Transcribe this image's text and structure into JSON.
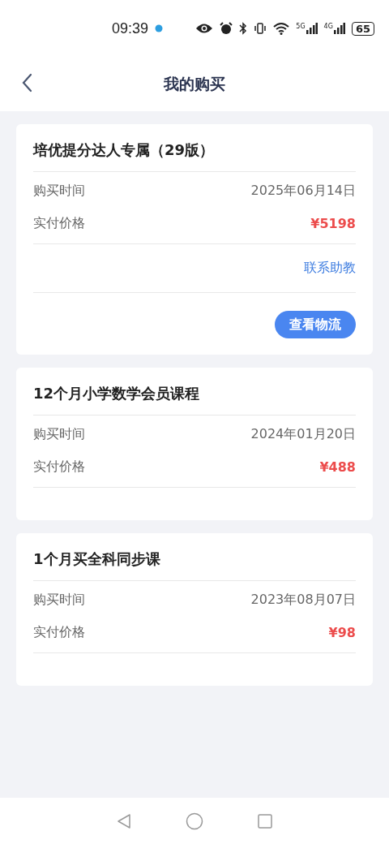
{
  "status_bar": {
    "time": "09:39",
    "network_5g": "5G",
    "network_4g": "4G",
    "battery": "65"
  },
  "header": {
    "title": "我的购买"
  },
  "orders": [
    {
      "title": "培优提分达人专属（29版）",
      "rows": [
        {
          "label": "购买时间",
          "value": "2025年06月14日",
          "kind": "date"
        },
        {
          "label": "实付价格",
          "value": "¥5198",
          "kind": "price"
        }
      ],
      "link": "联系助教",
      "button": "查看物流"
    },
    {
      "title": "12个月小学数学会员课程",
      "rows": [
        {
          "label": "购买时间",
          "value": "2024年01月20日",
          "kind": "date"
        },
        {
          "label": "实付价格",
          "value": "¥488",
          "kind": "price"
        }
      ]
    },
    {
      "title": "1个月买全科同步课",
      "rows": [
        {
          "label": "购买时间",
          "value": "2023年08月07日",
          "kind": "date"
        },
        {
          "label": "实付价格",
          "value": "¥98",
          "kind": "price"
        }
      ]
    }
  ]
}
